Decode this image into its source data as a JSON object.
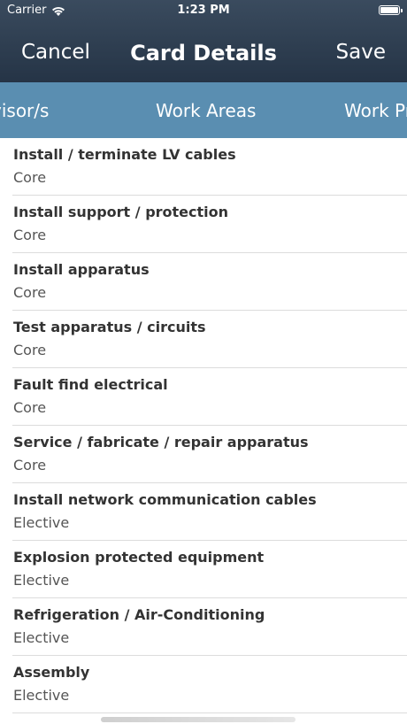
{
  "status_bar": {
    "carrier": "Carrier",
    "time": "1:23 PM"
  },
  "nav": {
    "cancel": "Cancel",
    "title": "Card Details",
    "save": "Save"
  },
  "tabs": [
    {
      "label": "visor/s"
    },
    {
      "label": "Work Areas"
    },
    {
      "label": "Work Pr"
    }
  ],
  "items": [
    {
      "title": "Install / terminate LV cables",
      "type": "Core"
    },
    {
      "title": "Install support / protection",
      "type": "Core"
    },
    {
      "title": "Install apparatus",
      "type": "Core"
    },
    {
      "title": "Test apparatus / circuits",
      "type": "Core"
    },
    {
      "title": "Fault find electrical",
      "type": "Core"
    },
    {
      "title": "Service / fabricate / repair apparatus",
      "type": "Core"
    },
    {
      "title": "Install network communication cables",
      "type": "Elective"
    },
    {
      "title": "Explosion protected equipment",
      "type": "Elective"
    },
    {
      "title": "Refrigeration / Air-Conditioning",
      "type": "Elective"
    },
    {
      "title": "Assembly",
      "type": "Elective"
    }
  ],
  "colors": {
    "header": "#2f3f52",
    "tab_bar": "#5a8eb1",
    "separator": "#dcdcdc"
  }
}
